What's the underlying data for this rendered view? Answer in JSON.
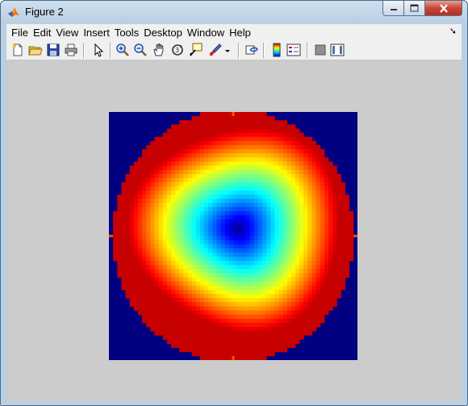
{
  "window": {
    "title": "Figure 2"
  },
  "menu": [
    "File",
    "Edit",
    "View",
    "Insert",
    "Tools",
    "Desktop",
    "Window",
    "Help"
  ],
  "toolbar": [
    {
      "name": "new-figure-icon"
    },
    {
      "name": "open-file-icon"
    },
    {
      "name": "save-icon"
    },
    {
      "name": "print-icon"
    },
    {
      "name": "select-arrow-icon"
    },
    {
      "name": "zoom-in-icon"
    },
    {
      "name": "zoom-out-icon"
    },
    {
      "name": "pan-hand-icon"
    },
    {
      "name": "rotate-3d-icon"
    },
    {
      "name": "data-cursor-icon"
    },
    {
      "name": "brush-icon"
    },
    {
      "name": "link-plot-icon"
    },
    {
      "name": "colorbar-icon"
    },
    {
      "name": "legend-icon"
    },
    {
      "name": "hide-plot-tools-icon"
    },
    {
      "name": "show-plot-tools-icon"
    }
  ],
  "colors": {
    "background": "#000080",
    "colormap": "jet",
    "tick": "#ff5000"
  },
  "chart_data": {
    "type": "heatmap",
    "colormap": "jet",
    "grid_size": [
      60,
      60
    ],
    "description_mode": "radial",
    "low_center": [
      0.52,
      0.47
    ],
    "outside_disk": "dark blue",
    "title": "",
    "xlabel": "",
    "ylabel": ""
  }
}
